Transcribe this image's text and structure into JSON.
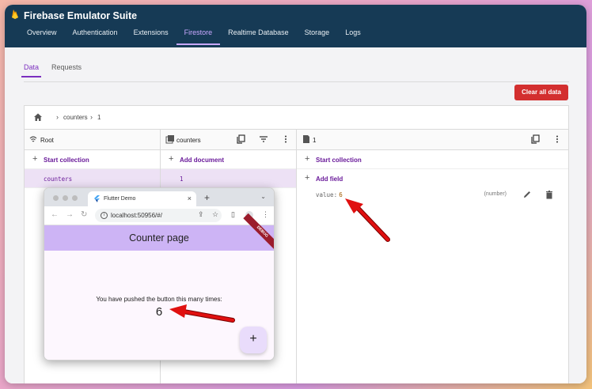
{
  "app": {
    "title": "Firebase Emulator Suite"
  },
  "nav": [
    "Overview",
    "Authentication",
    "Extensions",
    "Firestore",
    "Realtime Database",
    "Storage",
    "Logs"
  ],
  "subtabs": [
    "Data",
    "Requests"
  ],
  "clear_button": "Clear all data",
  "breadcrumb": {
    "collection": "counters",
    "doc": "1"
  },
  "columns": {
    "root": {
      "title": "Root",
      "action": "Start collection",
      "item": "counters"
    },
    "collection": {
      "title": "counters",
      "action": "Add document",
      "item": "1"
    },
    "document": {
      "title": "1",
      "action1": "Start collection",
      "action2": "Add field",
      "field": {
        "key": "value:",
        "value": "6",
        "type": "(number)"
      }
    }
  },
  "browser": {
    "tab_title": "Flutter Demo",
    "url": "localhost:50956/#/",
    "app_title": "Counter page",
    "debug_label": "DEBUG",
    "message": "You have pushed the button this many times:",
    "counter": "6",
    "fab_label": "+"
  },
  "colors": {
    "topbar": "#163a55",
    "accent": "#7b2fbf",
    "danger": "#d32f2f",
    "arrow": "#e01010"
  }
}
